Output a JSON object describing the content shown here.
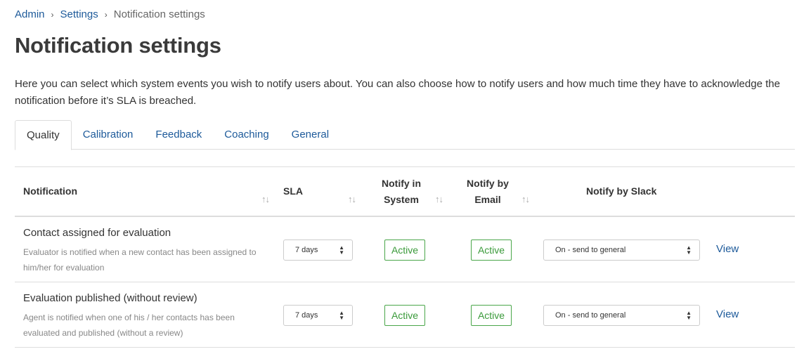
{
  "breadcrumb": {
    "items": [
      "Admin",
      "Settings"
    ],
    "current": "Notification settings",
    "separator": "›"
  },
  "page": {
    "title": "Notification settings",
    "description": "Here you can select which system events you wish to notify users about. You can also choose how to notify users and how much time they have to acknowledge the notification before it’s SLA is breached."
  },
  "tabs": [
    {
      "label": "Quality",
      "active": true
    },
    {
      "label": "Calibration",
      "active": false
    },
    {
      "label": "Feedback",
      "active": false
    },
    {
      "label": "Coaching",
      "active": false
    },
    {
      "label": "General",
      "active": false
    }
  ],
  "table": {
    "headers": {
      "notification": "Notification",
      "sla": "SLA",
      "system_line1": "Notify in",
      "system_line2": "System",
      "email_line1": "Notify by",
      "email_line2": "Email",
      "slack": "Notify by Slack"
    },
    "sort_icon": "↑↓",
    "rows": [
      {
        "title": "Contact assigned for evaluation",
        "description": "Evaluator is notified when a new contact has been assigned to him/her for evaluation",
        "sla": "7 days",
        "system": "Active",
        "email": "Active",
        "slack": "On - send to general",
        "view": "View"
      },
      {
        "title": "Evaluation published (without review)",
        "description": "Agent is notified when one of his / her contacts has been evaluated and published (without a review)",
        "sla": "7 days",
        "system": "Active",
        "email": "Active",
        "slack": "On - send to general",
        "view": "View"
      }
    ]
  },
  "colors": {
    "link": "#1d5a9a",
    "active_badge": "#3a9a3a",
    "border": "#dddddd"
  }
}
